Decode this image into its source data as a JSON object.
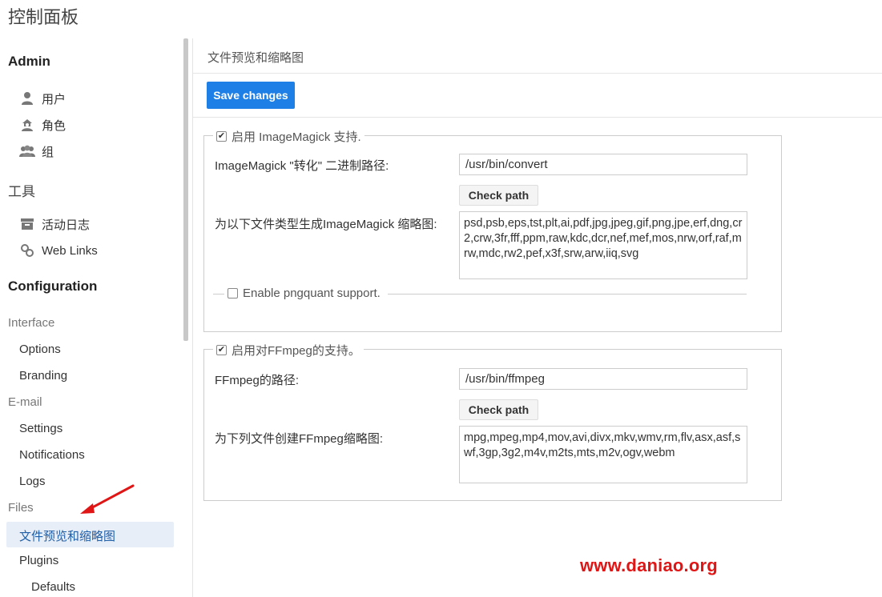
{
  "page": {
    "title": "控制面板"
  },
  "sidebar": {
    "admin": {
      "heading": "Admin",
      "items": [
        {
          "label": "用户",
          "icon": "user-icon"
        },
        {
          "label": "角色",
          "icon": "role-icon"
        },
        {
          "label": "组",
          "icon": "group-icon"
        }
      ]
    },
    "tools": {
      "heading": "工具",
      "items": [
        {
          "label": "活动日志",
          "icon": "archive-icon"
        },
        {
          "label": "Web Links",
          "icon": "link-icon"
        }
      ]
    },
    "configuration": {
      "heading": "Configuration",
      "interface": {
        "label": "Interface",
        "items": [
          "Options",
          "Branding"
        ]
      },
      "email": {
        "label": "E-mail",
        "items": [
          "Settings",
          "Notifications",
          "Logs"
        ]
      },
      "files": {
        "label": "Files",
        "active_item": "文件预览和缩略图",
        "items": [
          "Plugins"
        ]
      },
      "plugins_sub": [
        "Defaults"
      ]
    }
  },
  "main": {
    "title": "文件预览和缩略图",
    "save_label": "Save changes",
    "imagemagick": {
      "legend": "启用 ImageMagick 支持.",
      "enabled": true,
      "path_label": "ImageMagick \"转化\" 二进制路径:",
      "path_value": "/usr/bin/convert",
      "check_label": "Check path",
      "types_label": "为以下文件类型生成ImageMagick 缩略图:",
      "types_value": "psd,psb,eps,tst,plt,ai,pdf,jpg,jpeg,gif,png,jpe,erf,dng,cr2,crw,3fr,fff,ppm,raw,kdc,dcr,nef,mef,mos,nrw,orf,raf,mrw,mdc,rw2,pef,x3f,srw,arw,iiq,svg",
      "pngquant_label": "Enable pngquant support.",
      "pngquant_enabled": false
    },
    "ffmpeg": {
      "legend": "启用对FFmpeg的支持。",
      "enabled": true,
      "path_label": "FFmpeg的路径:",
      "path_value": "/usr/bin/ffmpeg",
      "check_label": "Check path",
      "types_label": "为下列文件创建FFmpeg缩略图:",
      "types_value": "mpg,mpeg,mp4,mov,avi,divx,mkv,wmv,rm,flv,asx,asf,swf,3gp,3g2,m4v,m2ts,mts,m2v,ogv,webm"
    }
  },
  "watermark": "www.daniao.org",
  "colors": {
    "primary": "#1e80e6",
    "active_bg": "#e8eef8",
    "watermark": "#e01515"
  }
}
